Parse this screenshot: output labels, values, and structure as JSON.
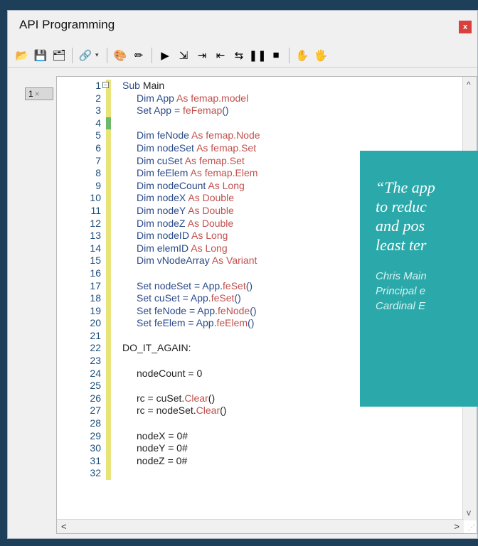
{
  "window": {
    "title": "API Programming",
    "close_label": "x"
  },
  "toolbar": {
    "buttons": [
      {
        "name": "open-icon",
        "glyph": "📂"
      },
      {
        "name": "save-icon",
        "glyph": "💾"
      },
      {
        "name": "save-all-icon",
        "glyph": "🗂"
      },
      {
        "name": "references-icon",
        "glyph": "🔗"
      },
      {
        "name": "browse-icon",
        "glyph": "🎨"
      },
      {
        "name": "edit-icon",
        "glyph": "✏"
      },
      {
        "name": "run-icon",
        "glyph": "▶"
      },
      {
        "name": "step-into-icon",
        "glyph": "⇲"
      },
      {
        "name": "step-over-icon",
        "glyph": "⇥"
      },
      {
        "name": "step-out-icon",
        "glyph": "⇤"
      },
      {
        "name": "toggle-breakpoint-icon",
        "glyph": "⇆"
      },
      {
        "name": "pause-icon",
        "glyph": "❚❚"
      },
      {
        "name": "stop-icon",
        "glyph": "■"
      },
      {
        "name": "hand-icon",
        "glyph": "✋"
      },
      {
        "name": "hand-gear-icon",
        "glyph": "🖐"
      }
    ]
  },
  "editor_tab": {
    "label": "1",
    "close": "×"
  },
  "code_lines": [
    {
      "n": "1",
      "parts": [
        [
          "kw",
          "Sub "
        ],
        [
          "plain",
          "Main"
        ]
      ],
      "indent": 0,
      "fold": true
    },
    {
      "n": "2",
      "parts": [
        [
          "kw",
          "Dim "
        ],
        [
          "kw",
          "App "
        ],
        [
          "tp",
          "As femap.model"
        ]
      ],
      "indent": 1
    },
    {
      "n": "3",
      "parts": [
        [
          "kw",
          "Set "
        ],
        [
          "kw",
          "App = "
        ],
        [
          "mb",
          "feFemap"
        ],
        [
          "kw",
          "()"
        ]
      ],
      "indent": 1
    },
    {
      "n": "4",
      "parts": [],
      "indent": 1
    },
    {
      "n": "5",
      "parts": [
        [
          "kw",
          "Dim "
        ],
        [
          "kw",
          "feNode "
        ],
        [
          "tp",
          "As femap.Node"
        ]
      ],
      "indent": 1
    },
    {
      "n": "6",
      "parts": [
        [
          "kw",
          "Dim "
        ],
        [
          "kw",
          "nodeSet "
        ],
        [
          "tp",
          "As femap.Set"
        ]
      ],
      "indent": 1
    },
    {
      "n": "7",
      "parts": [
        [
          "kw",
          "Dim "
        ],
        [
          "kw",
          "cuSet "
        ],
        [
          "tp",
          "As femap.Set"
        ]
      ],
      "indent": 1
    },
    {
      "n": "8",
      "parts": [
        [
          "kw",
          "Dim "
        ],
        [
          "kw",
          "feElem "
        ],
        [
          "tp",
          "As femap.Elem"
        ]
      ],
      "indent": 1
    },
    {
      "n": "9",
      "parts": [
        [
          "kw",
          "Dim "
        ],
        [
          "kw",
          "nodeCount "
        ],
        [
          "tp",
          "As Long"
        ]
      ],
      "indent": 1
    },
    {
      "n": "10",
      "parts": [
        [
          "kw",
          "Dim "
        ],
        [
          "kw",
          "nodeX "
        ],
        [
          "tp",
          "As Double"
        ]
      ],
      "indent": 1
    },
    {
      "n": "11",
      "parts": [
        [
          "kw",
          "Dim "
        ],
        [
          "kw",
          "nodeY "
        ],
        [
          "tp",
          "As Double"
        ]
      ],
      "indent": 1
    },
    {
      "n": "12",
      "parts": [
        [
          "kw",
          "Dim "
        ],
        [
          "kw",
          "nodeZ "
        ],
        [
          "tp",
          "As Double"
        ]
      ],
      "indent": 1
    },
    {
      "n": "13",
      "parts": [
        [
          "kw",
          "Dim "
        ],
        [
          "kw",
          "nodeID "
        ],
        [
          "tp",
          "As Long"
        ]
      ],
      "indent": 1
    },
    {
      "n": "14",
      "parts": [
        [
          "kw",
          "Dim "
        ],
        [
          "kw",
          "elemID "
        ],
        [
          "tp",
          "As Long"
        ]
      ],
      "indent": 1
    },
    {
      "n": "15",
      "parts": [
        [
          "kw",
          "Dim "
        ],
        [
          "kw",
          "vNodeArray "
        ],
        [
          "tp",
          "As Variant"
        ]
      ],
      "indent": 1
    },
    {
      "n": "16",
      "parts": [],
      "indent": 1
    },
    {
      "n": "17",
      "parts": [
        [
          "kw",
          "Set "
        ],
        [
          "kw",
          "nodeSet = App."
        ],
        [
          "mb",
          "feSet"
        ],
        [
          "kw",
          "()"
        ]
      ],
      "indent": 1
    },
    {
      "n": "18",
      "parts": [
        [
          "kw",
          "Set "
        ],
        [
          "kw",
          "cuSet = App."
        ],
        [
          "mb",
          "feSet"
        ],
        [
          "kw",
          "()"
        ]
      ],
      "indent": 1
    },
    {
      "n": "19",
      "parts": [
        [
          "kw",
          "Set "
        ],
        [
          "kw",
          "feNode = App."
        ],
        [
          "mb",
          "feNode"
        ],
        [
          "kw",
          "()"
        ]
      ],
      "indent": 1
    },
    {
      "n": "20",
      "parts": [
        [
          "kw",
          "Set "
        ],
        [
          "kw",
          "feElem = App."
        ],
        [
          "mb",
          "feElem"
        ],
        [
          "kw",
          "()"
        ]
      ],
      "indent": 1
    },
    {
      "n": "21",
      "parts": [],
      "indent": 0
    },
    {
      "n": "22",
      "parts": [
        [
          "plain",
          "DO_IT_AGAIN:"
        ]
      ],
      "indent": 0
    },
    {
      "n": "23",
      "parts": [],
      "indent": 0
    },
    {
      "n": "24",
      "parts": [
        [
          "plain",
          "nodeCount = 0"
        ]
      ],
      "indent": 1
    },
    {
      "n": "25",
      "parts": [],
      "indent": 1
    },
    {
      "n": "26",
      "parts": [
        [
          "plain",
          "rc = cuSet."
        ],
        [
          "mb",
          "Clear"
        ],
        [
          "plain",
          "()"
        ]
      ],
      "indent": 1
    },
    {
      "n": "27",
      "parts": [
        [
          "plain",
          "rc = nodeSet."
        ],
        [
          "mb",
          "Clear"
        ],
        [
          "plain",
          "()"
        ]
      ],
      "indent": 1
    },
    {
      "n": "28",
      "parts": [],
      "indent": 1
    },
    {
      "n": "29",
      "parts": [
        [
          "plain",
          "nodeX = 0#"
        ]
      ],
      "indent": 1
    },
    {
      "n": "30",
      "parts": [
        [
          "plain",
          "nodeY = 0#"
        ]
      ],
      "indent": 1
    },
    {
      "n": "31",
      "parts": [
        [
          "plain",
          "nodeZ = 0#"
        ]
      ],
      "indent": 1
    },
    {
      "n": "32",
      "parts": [],
      "indent": 1
    }
  ],
  "quote": {
    "lines": [
      "“The app",
      "to reduc",
      "and pos",
      "least ter"
    ],
    "attribution": [
      "Chris Main",
      "Principal e",
      "Cardinal E"
    ]
  },
  "scroll": {
    "up": "^",
    "down": "v",
    "left": "<",
    "right": ">",
    "grip": "⋰"
  }
}
